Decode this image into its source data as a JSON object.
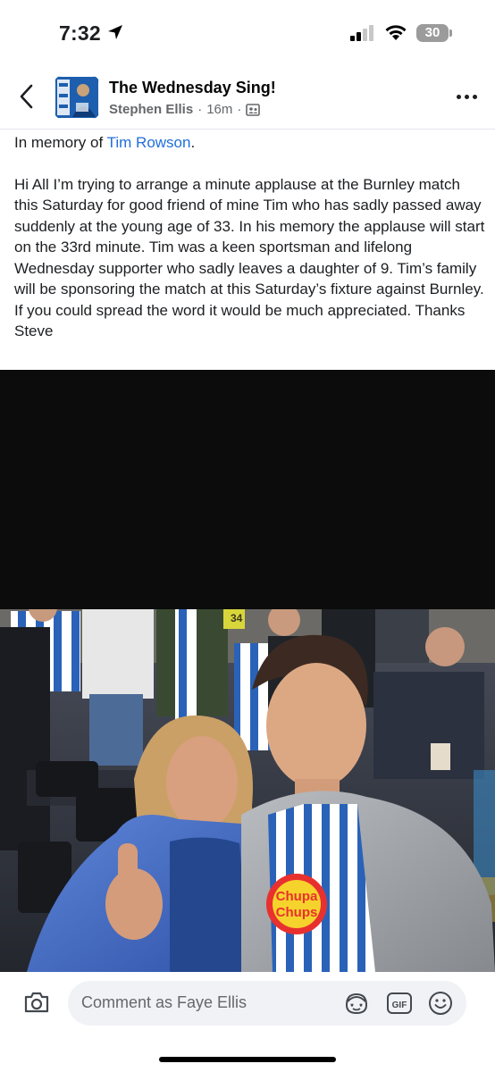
{
  "status_bar": {
    "time": "7:32",
    "battery": "30",
    "icons": [
      "location-arrow-icon",
      "signal-icon",
      "wifi-icon",
      "battery-icon"
    ]
  },
  "header": {
    "group_name": "The Wednesday Sing!",
    "author": "Stephen Ellis",
    "time_ago": "16m",
    "separator": "·",
    "icons": [
      "back-chevron-icon",
      "group-privacy-icon",
      "more-dots-icon"
    ]
  },
  "post": {
    "memory_prefix": "In memory of ",
    "memory_name": "Tim Rowson",
    "memory_suffix": ".",
    "body": "Hi All I’m trying to arrange a minute applause at the Burnley match this Saturday for good friend of mine Tim who has sadly passed away suddenly at the young age of 33. In his memory the applause will start on the 33rd minute. Tim was a keen sportsman and lifelong Wednesday supporter who sadly leaves a daughter of 9. Tim’s family will be sponsoring the match at this Saturday’s fixture against Burnley. If you could spread the word it would be much appreciated. Thanks Steve",
    "photo_text": {
      "shirt_brand_top": "Chupa",
      "shirt_brand_bottom": "Chups",
      "stand_number": "34"
    }
  },
  "comment_bar": {
    "placeholder": "Comment as Faye Ellis",
    "gif_label": "GIF",
    "icons": [
      "camera-icon",
      "avatar-sticker-icon",
      "gif-icon",
      "emoji-icon"
    ]
  },
  "colors": {
    "mention_blue": "#216fdb",
    "muted_text": "#65676b",
    "input_bg": "#f0f2f5",
    "media_black": "#0c0c0c",
    "battery_gray": "#9b9b9b"
  }
}
